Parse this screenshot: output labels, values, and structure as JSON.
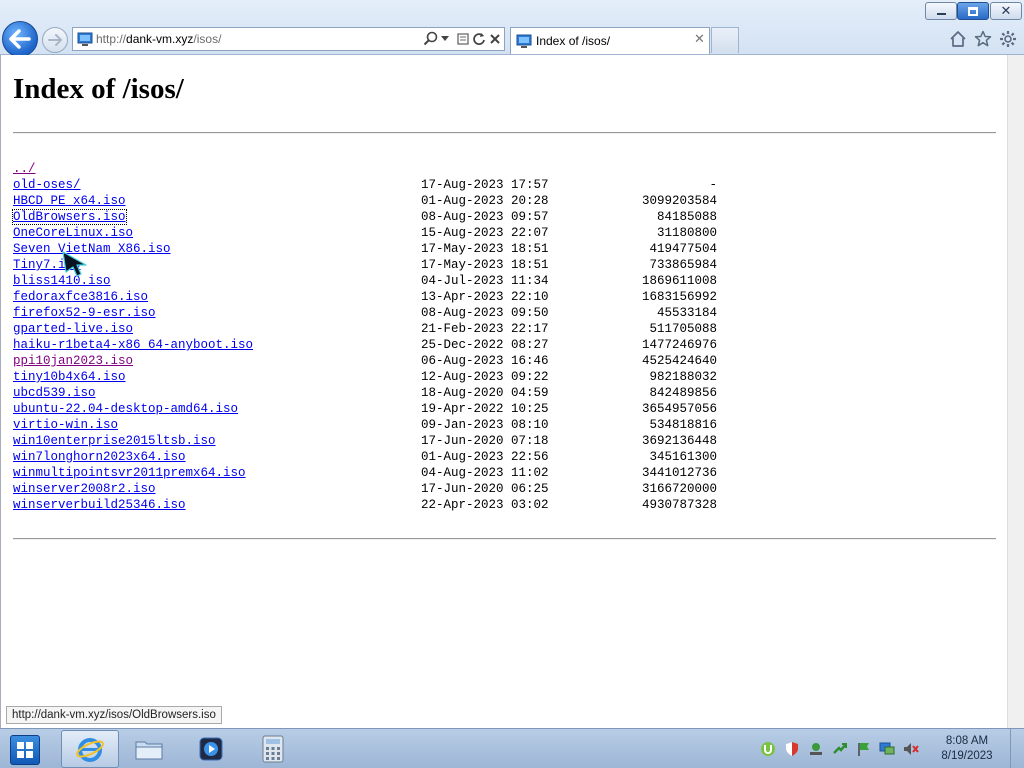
{
  "browser": {
    "address": {
      "scheme": "http://",
      "domain": "dank-vm.xyz",
      "path": "/isos/"
    },
    "tab_title": "Index of /isos/",
    "window_controls": {
      "minimize": "minimize-icon",
      "restore": "restore-icon",
      "close": "close-icon"
    },
    "command_icons": [
      "home-icon",
      "favorites-star-icon",
      "tools-gear-icon"
    ]
  },
  "page": {
    "title": "Index of /isos/",
    "parent_link": "../",
    "entries": [
      {
        "name": "old-oses/",
        "date": "17-Aug-2023 17:57",
        "size": "-"
      },
      {
        "name": "HBCD_PE_x64.iso",
        "date": "01-Aug-2023 20:28",
        "size": "3099203584"
      },
      {
        "name": "OldBrowsers.iso",
        "date": "08-Aug-2023 09:57",
        "size": "84185088"
      },
      {
        "name": "OneCoreLinux.iso",
        "date": "15-Aug-2023 22:07",
        "size": "31180800"
      },
      {
        "name": "Seven_VietNam_X86.iso",
        "date": "17-May-2023 18:51",
        "size": "419477504"
      },
      {
        "name": "Tiny7.iso",
        "date": "17-May-2023 18:51",
        "size": "733865984"
      },
      {
        "name": "bliss1410.iso",
        "date": "04-Jul-2023 11:34",
        "size": "1869611008"
      },
      {
        "name": "fedoraxfce3816.iso",
        "date": "13-Apr-2023 22:10",
        "size": "1683156992"
      },
      {
        "name": "firefox52-9-esr.iso",
        "date": "08-Aug-2023 09:50",
        "size": "45533184"
      },
      {
        "name": "gparted-live.iso",
        "date": "21-Feb-2023 22:17",
        "size": "511705088"
      },
      {
        "name": "haiku-r1beta4-x86_64-anyboot.iso",
        "date": "25-Dec-2022 08:27",
        "size": "1477246976"
      },
      {
        "name": "ppi10jan2023.iso",
        "date": "06-Aug-2023 16:46",
        "size": "4525424640"
      },
      {
        "name": "tiny10b4x64.iso",
        "date": "12-Aug-2023 09:22",
        "size": "982188032"
      },
      {
        "name": "ubcd539.iso",
        "date": "18-Aug-2020 04:59",
        "size": "842489856"
      },
      {
        "name": "ubuntu-22.04-desktop-amd64.iso",
        "date": "19-Apr-2022 10:25",
        "size": "3654957056"
      },
      {
        "name": "virtio-win.iso",
        "date": "09-Jan-2023 08:10",
        "size": "534818816"
      },
      {
        "name": "win10enterprise2015ltsb.iso",
        "date": "17-Jun-2020 07:18",
        "size": "3692136448"
      },
      {
        "name": "win7longhorn2023x64.iso",
        "date": "01-Aug-2023 22:56",
        "size": "345161300"
      },
      {
        "name": "winmultipointsvr2011premx64.iso",
        "date": "04-Aug-2023 11:02",
        "size": "3441012736"
      },
      {
        "name": "winserver2008r2.iso",
        "date": "17-Jun-2020 06:25",
        "size": "3166720000"
      },
      {
        "name": "winserverbuild25346.iso",
        "date": "22-Apr-2023 03:02",
        "size": "4930787328"
      }
    ],
    "visited": [
      "../",
      "ppi10jan2023.iso"
    ],
    "focused": "OldBrowsers.iso"
  },
  "status_tooltip": "http://dank-vm.xyz/isos/OldBrowsers.iso",
  "taskbar": {
    "pinned": [
      "internet-explorer-icon",
      "file-explorer-icon",
      "media-player-icon",
      "calculator-icon"
    ],
    "clock": {
      "time": "8:08 AM",
      "date": "8/19/2023"
    }
  },
  "colors": {
    "link": "#0000ee",
    "visited": "#800080",
    "chrome": "#d9e6f4",
    "taskbar": "#a9c0dd"
  }
}
